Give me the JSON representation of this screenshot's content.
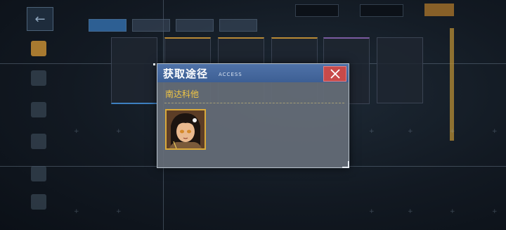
{
  "dialog": {
    "title": "获取途径",
    "subtitle": "ACCESS",
    "close_icon": "close-icon",
    "source": {
      "label": "南达科他",
      "item_icon": "shipgirl-portrait-icon"
    }
  },
  "colors": {
    "header": "#3d5f94",
    "close": "#c84a4a",
    "source_text": "#f1c644",
    "item_border": "#d9a93a"
  }
}
